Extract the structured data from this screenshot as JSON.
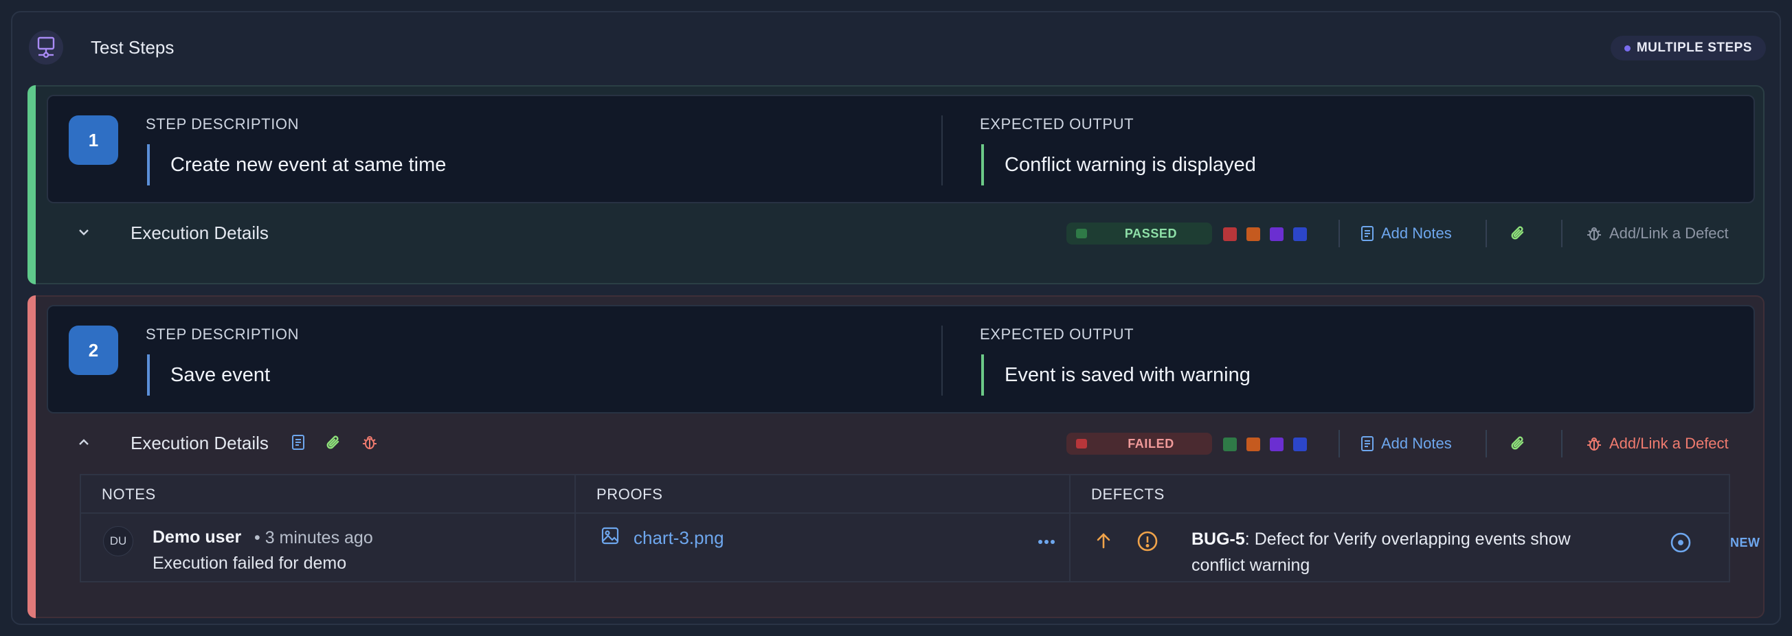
{
  "header": {
    "title": "Test Steps",
    "badge": "MULTIPLE STEPS",
    "icon": "test-steps-icon"
  },
  "labels": {
    "step_description": "STEP DESCRIPTION",
    "expected_output": "EXPECTED OUTPUT",
    "execution_details": "Execution Details",
    "add_notes": "Add Notes",
    "add_link_defect": "Add/Link a Defect"
  },
  "steps": [
    {
      "number": "1",
      "description": "Create new event at same time",
      "expected": "Conflict warning is displayed",
      "status": "PASSED",
      "expanded": false
    },
    {
      "number": "2",
      "description": "Save event",
      "expected": "Event is saved with warning",
      "status": "FAILED",
      "expanded": true
    }
  ],
  "status_swatches": [
    "#b8363a",
    "#c55a1f",
    "#6b2fd1",
    "#2c46c9",
    "#2f7a47"
  ],
  "details": {
    "headers": {
      "notes": "NOTES",
      "proofs": "PROOFS",
      "defects": "DEFECTS"
    },
    "note": {
      "avatar": "DU",
      "user": "Demo user",
      "time": "• 3 minutes ago",
      "text": "Execution failed for demo"
    },
    "proof": {
      "file": "chart-3.png"
    },
    "defect": {
      "id": "BUG-5",
      "title": ": Defect for Verify overlapping events show conflict warning",
      "status": "NEW"
    }
  },
  "colors": {
    "pass_accent": "#5fc98b",
    "fail_accent": "#e07a7a",
    "link_blue": "#6ea7ee",
    "defect_red": "#f07b6f"
  }
}
